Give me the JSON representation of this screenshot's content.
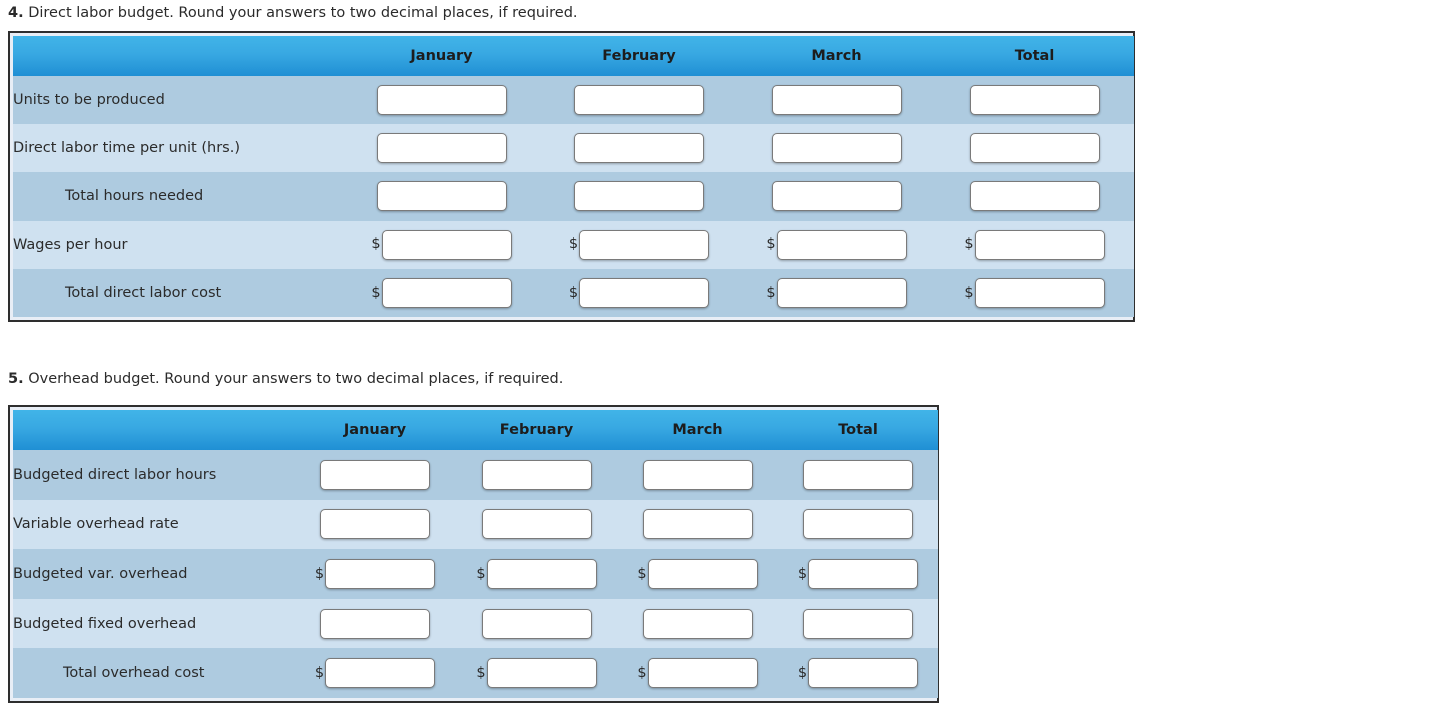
{
  "questions": [
    {
      "number": "4.",
      "text": " Direct labor budget. Round your answers to two decimal places, if required."
    },
    {
      "number": "5.",
      "text": " Overhead budget. Round your answers to two decimal places, if required."
    }
  ],
  "tables": [
    {
      "id": "direct-labor-budget",
      "columns": [
        "",
        "January",
        "February",
        "March",
        "Total"
      ],
      "rows": [
        {
          "label": "Units to be produced",
          "indent": false,
          "currency": false,
          "values": [
            "",
            "",
            "",
            ""
          ],
          "placeholders": [
            "",
            "",
            "",
            ""
          ]
        },
        {
          "label": "Direct labor time per unit (hrs.)",
          "indent": false,
          "currency": false,
          "values": [
            "",
            "",
            "",
            ""
          ],
          "placeholders": [
            "",
            "",
            "",
            ""
          ]
        },
        {
          "label": "Total hours needed",
          "indent": true,
          "currency": false,
          "values": [
            "",
            "",
            "",
            ""
          ],
          "placeholders": [
            "",
            "",
            "",
            ""
          ]
        },
        {
          "label": "Wages per hour",
          "indent": false,
          "currency": true,
          "currency_symbol": "$",
          "values": [
            "",
            "",
            "",
            ""
          ],
          "placeholders": [
            "",
            "",
            "",
            ""
          ]
        },
        {
          "label": "Total direct labor cost",
          "indent": true,
          "currency": true,
          "currency_symbol": "$",
          "values": [
            "",
            "",
            "",
            ""
          ],
          "placeholders": [
            "",
            "",
            "",
            ""
          ]
        }
      ]
    },
    {
      "id": "overhead-budget",
      "columns": [
        "",
        "January",
        "February",
        "March",
        "Total"
      ],
      "rows": [
        {
          "label": "Budgeted direct labor hours",
          "indent": false,
          "currency": false,
          "values": [
            "",
            "",
            "",
            ""
          ],
          "placeholders": [
            "",
            "",
            "",
            ""
          ]
        },
        {
          "label": "Variable overhead rate",
          "indent": false,
          "currency": false,
          "values": [
            "",
            "",
            "",
            ""
          ],
          "placeholders": [
            "",
            "",
            "",
            ""
          ]
        },
        {
          "label": "Budgeted var. overhead",
          "indent": false,
          "currency": true,
          "currency_symbol": "$",
          "values": [
            "",
            "",
            "",
            ""
          ],
          "placeholders": [
            "",
            "",
            "",
            ""
          ]
        },
        {
          "label": "Budgeted fixed overhead",
          "indent": false,
          "currency": false,
          "values": [
            "",
            "",
            "",
            ""
          ],
          "placeholders": [
            "",
            "",
            "",
            ""
          ]
        },
        {
          "label": "Total overhead cost",
          "indent": true,
          "currency": true,
          "currency_symbol": "$",
          "values": [
            "",
            "",
            "",
            ""
          ],
          "placeholders": [
            "",
            "",
            "",
            ""
          ]
        }
      ]
    }
  ],
  "colors": {
    "header_blue_top": "#41b4e8",
    "header_blue_bottom": "#1f8fd4",
    "row_dark": "#aecbe0",
    "row_light": "#cfe1f0",
    "table_border": "#2e2e2e",
    "table_pad_bg": "#e8eef6"
  }
}
